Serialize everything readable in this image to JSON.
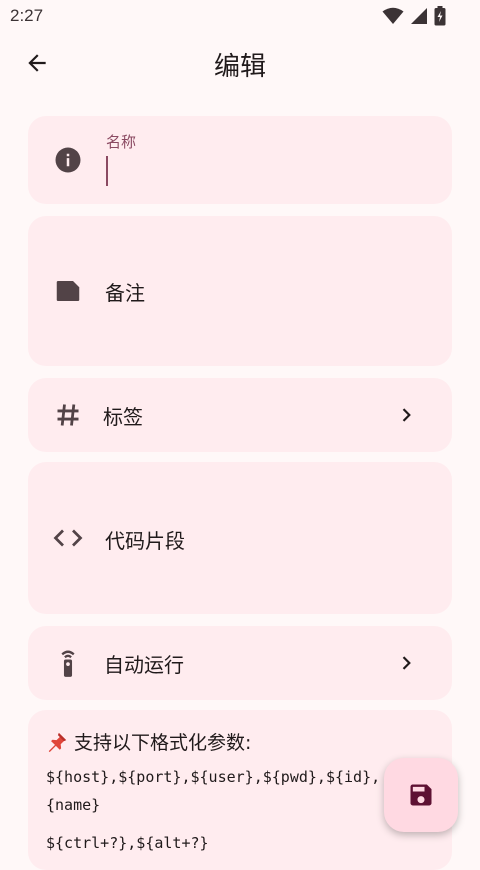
{
  "status_bar": {
    "time": "2:27"
  },
  "header": {
    "title": "编辑"
  },
  "form": {
    "name_label": "名称",
    "note_label": "备注",
    "tags_label": "标签",
    "snippet_label": "代码片段",
    "autorun_label": "自动运行"
  },
  "info": {
    "title": "支持以下格式化参数:",
    "line1": "${host},${port},${user},${pwd},${id},",
    "line2": "{name}",
    "line3": "${ctrl+?},${alt+?}"
  },
  "colors": {
    "background": "#fff8f8",
    "card": "#ffecef",
    "accent": "#8b4a62",
    "fab": "#ffd9e2"
  },
  "icons": [
    "back-arrow-icon",
    "info-icon",
    "note-icon",
    "hashtag-icon",
    "code-icon",
    "remote-icon",
    "chevron-right-icon",
    "save-icon",
    "wifi-icon",
    "cell-signal-icon",
    "battery-icon",
    "pin-icon"
  ]
}
